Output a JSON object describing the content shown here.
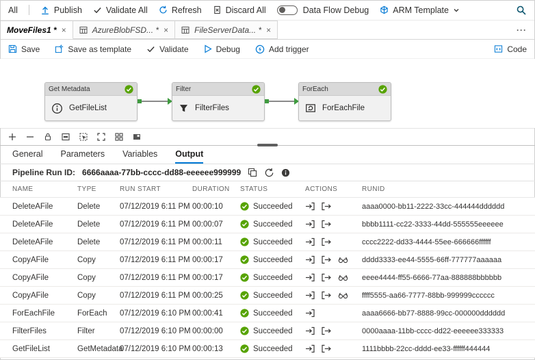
{
  "colors": {
    "accent": "#0078d4",
    "success": "#57a300"
  },
  "icons": {
    "close": "×",
    "more": "···"
  },
  "topbar": {
    "all": "All",
    "publish": "Publish",
    "validate_all": "Validate All",
    "refresh": "Refresh",
    "discard_all": "Discard All",
    "data_flow_debug": "Data Flow Debug",
    "arm_template": "ARM Template"
  },
  "tabs": {
    "items": [
      {
        "label": "MoveFiles1 *"
      },
      {
        "label": "AzureBlobFSD... *"
      },
      {
        "label": "FileServerData... *"
      }
    ]
  },
  "toolbar": {
    "save": "Save",
    "save_as_template": "Save as template",
    "validate": "Validate",
    "debug": "Debug",
    "add_trigger": "Add trigger",
    "code": "Code"
  },
  "canvas": {
    "activities": [
      {
        "type": "Get Metadata",
        "name": "GetFileList",
        "status": "Succeeded"
      },
      {
        "type": "Filter",
        "name": "FilterFiles",
        "status": "Succeeded"
      },
      {
        "type": "ForEach",
        "name": "ForEachFile",
        "status": "Succeeded"
      }
    ]
  },
  "panel": {
    "tabs": [
      "General",
      "Parameters",
      "Variables",
      "Output"
    ],
    "active_tab": "Output",
    "run_id_label": "Pipeline Run ID:",
    "run_id": "6666aaaa-77bb-cccc-dd88-eeeeee999999",
    "table": {
      "headers": [
        "NAME",
        "TYPE",
        "RUN START",
        "DURATION",
        "STATUS",
        "ACTIONS",
        "RUNID"
      ],
      "rows": [
        {
          "name": "DeleteAFile",
          "type": "Delete",
          "run_start": "07/12/2019 6:11 PM",
          "duration": "00:00:10",
          "status": "Succeeded",
          "actions": [
            "input",
            "output"
          ],
          "run_id": "aaaa0000-bb11-2222-33cc-444444dddddd"
        },
        {
          "name": "DeleteAFile",
          "type": "Delete",
          "run_start": "07/12/2019 6:11 PM",
          "duration": "00:00:07",
          "status": "Succeeded",
          "actions": [
            "input",
            "output"
          ],
          "run_id": "bbbb1111-cc22-3333-44dd-555555eeeeee"
        },
        {
          "name": "DeleteAFile",
          "type": "Delete",
          "run_start": "07/12/2019 6:11 PM",
          "duration": "00:00:11",
          "status": "Succeeded",
          "actions": [
            "input",
            "output"
          ],
          "run_id": "cccc2222-dd33-4444-55ee-666666ffffff"
        },
        {
          "name": "CopyAFile",
          "type": "Copy",
          "run_start": "07/12/2019 6:11 PM",
          "duration": "00:00:17",
          "status": "Succeeded",
          "actions": [
            "input",
            "output",
            "details"
          ],
          "run_id": "dddd3333-ee44-5555-66ff-777777aaaaaa"
        },
        {
          "name": "CopyAFile",
          "type": "Copy",
          "run_start": "07/12/2019 6:11 PM",
          "duration": "00:00:17",
          "status": "Succeeded",
          "actions": [
            "input",
            "output",
            "details"
          ],
          "run_id": "eeee4444-ff55-6666-77aa-888888bbbbbb"
        },
        {
          "name": "CopyAFile",
          "type": "Copy",
          "run_start": "07/12/2019 6:11 PM",
          "duration": "00:00:25",
          "status": "Succeeded",
          "actions": [
            "input",
            "output",
            "details"
          ],
          "run_id": "ffff5555-aa66-7777-88bb-999999cccccc"
        },
        {
          "name": "ForEachFile",
          "type": "ForEach",
          "run_start": "07/12/2019 6:10 PM",
          "duration": "00:00:41",
          "status": "Succeeded",
          "actions": [
            "input"
          ],
          "run_id": "aaaa6666-bb77-8888-99cc-000000dddddd"
        },
        {
          "name": "FilterFiles",
          "type": "Filter",
          "run_start": "07/12/2019 6:10 PM",
          "duration": "00:00:00",
          "status": "Succeeded",
          "actions": [
            "input",
            "output"
          ],
          "run_id": "0000aaaa-11bb-cccc-dd22-eeeeee333333"
        },
        {
          "name": "GetFileList",
          "type": "GetMetadata",
          "run_start": "07/12/2019 6:10 PM",
          "duration": "00:00:13",
          "status": "Succeeded",
          "actions": [
            "input",
            "output"
          ],
          "run_id": "1111bbbb-22cc-dddd-ee33-ffffff444444"
        }
      ]
    }
  }
}
